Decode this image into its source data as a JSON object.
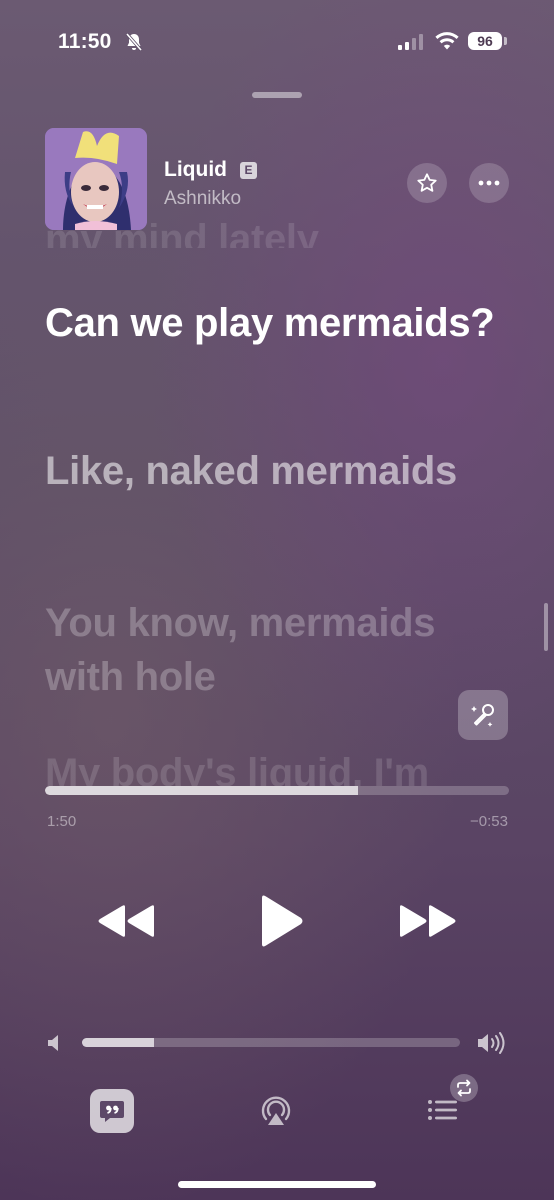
{
  "status_bar": {
    "time": "11:50",
    "battery": "96",
    "icons": [
      "bell-slash-icon",
      "cellular-signal-icon",
      "wifi-icon",
      "battery-icon"
    ]
  },
  "now_playing": {
    "title": "Liquid",
    "explicit_badge": "E",
    "artist": "Ashnikko",
    "art_colors": {
      "bg": "#8a6fb8",
      "hat": "#f1e07a",
      "hair": "#2f2f6e"
    }
  },
  "lyrics": {
    "previous_line": "my mind lately",
    "active_line": "Can we play mermaids?",
    "next_lines": [
      "Like, naked mermaids",
      "You know, mermaids with hole",
      "My body's liquid, I'm"
    ]
  },
  "progress": {
    "elapsed": "1:50",
    "remaining": "−0:53",
    "fraction": 0.675
  },
  "volume": {
    "fraction": 0.19
  },
  "header_buttons": [
    "star-icon",
    "more-icon"
  ],
  "transport": [
    "rewind-icon",
    "play-icon",
    "fast-forward-icon"
  ],
  "bottom_bar": [
    "lyrics-icon",
    "airplay-icon",
    "queue-icon",
    "repeat-icon"
  ]
}
